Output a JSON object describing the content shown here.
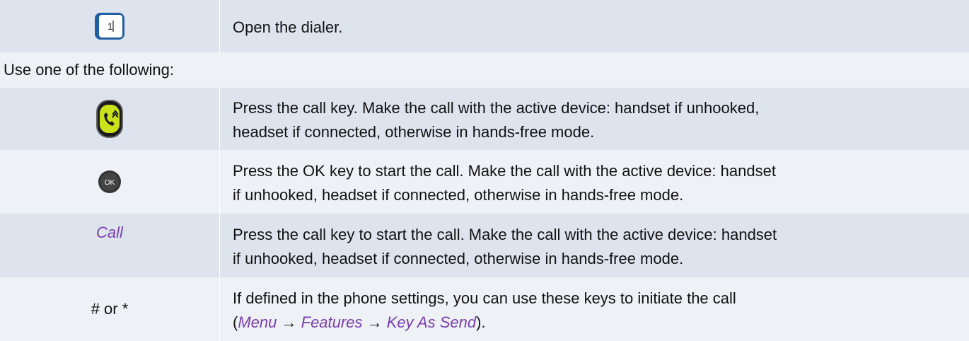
{
  "rows": [
    {
      "icon": "dialer-icon",
      "label": "1",
      "text": "Open the dialer."
    },
    {
      "header": "Use one of the following:"
    },
    {
      "icon": "call-key-icon",
      "line1": "Press the call key. Make the call with the active device: handset if unhooked,",
      "line2": "headset if connected, otherwise in hands-free mode."
    },
    {
      "icon": "ok-key-icon",
      "label": "OK",
      "line1": "Press the OK key to start the call. Make the call with the active device: handset",
      "line2": "if unhooked, headset if connected, otherwise in hands-free mode."
    },
    {
      "key": "Call",
      "line1": "Press the call key to start the call. Make the call with the active device: handset",
      "line2": "if unhooked, headset if connected, otherwise in hands-free mode."
    },
    {
      "key": "# or *",
      "line1": "If defined in the phone settings, you can use these keys to initiate the call",
      "path_open": "(",
      "path_menu": "Menu",
      "path_arrow1": "→",
      "path_features": "Features",
      "path_arrow2": "→",
      "path_key": "Key As Send",
      "path_close": ")."
    }
  ],
  "colors": {
    "band_dark": "#dde4ee",
    "band_light": "#eef1f6",
    "link": "#7a3eb0",
    "phone_blue": "#1f5fa3",
    "call_green": "#c9e21a"
  }
}
